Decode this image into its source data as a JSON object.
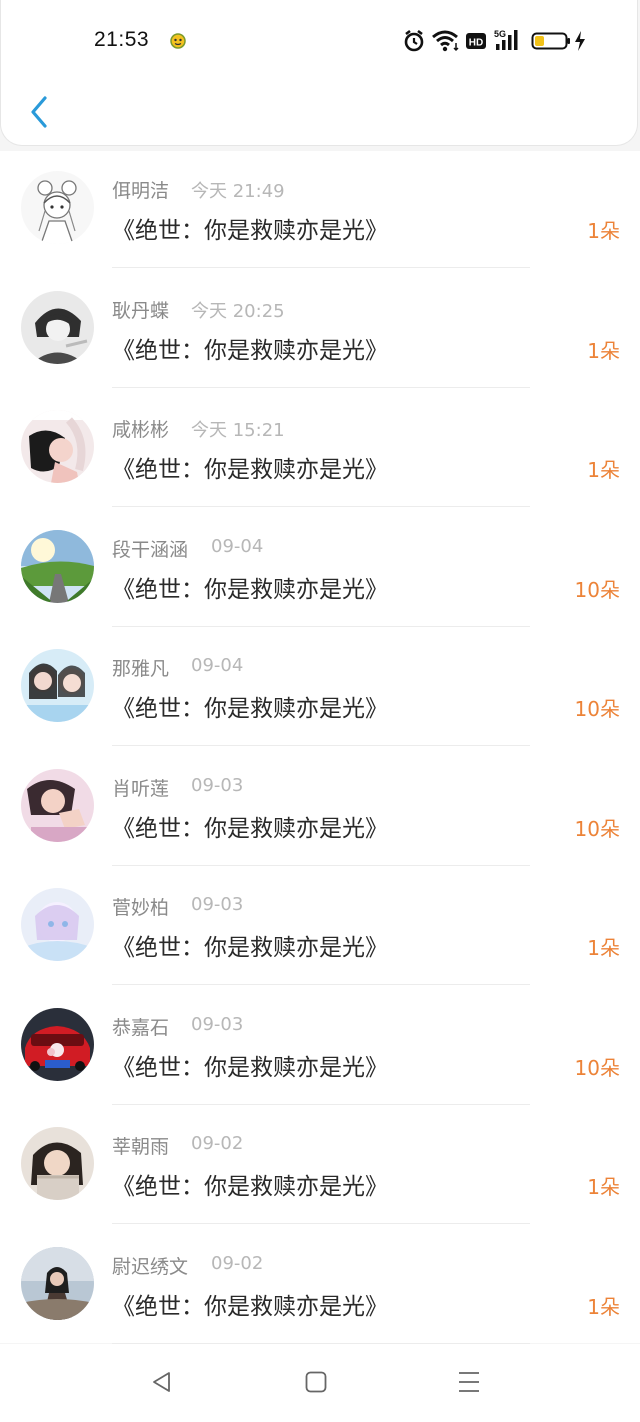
{
  "status_bar": {
    "time": "21:53",
    "icons": [
      "notification-icon",
      "alarm-icon",
      "wifi-icon",
      "hd-icon",
      "signal-5g-icon",
      "battery-icon",
      "charging-icon"
    ],
    "hd_label": "HD",
    "network_label": "5G"
  },
  "header": {
    "back_icon": "chevron-left-icon"
  },
  "colors": {
    "accent_blue": "#2a9ad9",
    "count_orange": "#ec8338"
  },
  "items": [
    {
      "name": "佴明洁",
      "time": "今天 21:49",
      "title": "《绝世：你是救赎亦是光》",
      "count": "1朵"
    },
    {
      "name": "耿丹蝶",
      "time": "今天 20:25",
      "title": "《绝世：你是救赎亦是光》",
      "count": "1朵"
    },
    {
      "name": "咸彬彬",
      "time": "今天 15:21",
      "title": "《绝世：你是救赎亦是光》",
      "count": "1朵"
    },
    {
      "name": "段干涵涵",
      "time": "09-04",
      "title": "《绝世：你是救赎亦是光》",
      "count": "10朵"
    },
    {
      "name": "那雅凡",
      "time": "09-04",
      "title": "《绝世：你是救赎亦是光》",
      "count": "10朵"
    },
    {
      "name": "肖听莲",
      "time": "09-03",
      "title": "《绝世：你是救赎亦是光》",
      "count": "10朵"
    },
    {
      "name": "菅妙柏",
      "time": "09-03",
      "title": "《绝世：你是救赎亦是光》",
      "count": "1朵"
    },
    {
      "name": "恭嘉石",
      "time": "09-03",
      "title": "《绝世：你是救赎亦是光》",
      "count": "10朵"
    },
    {
      "name": "莘朝雨",
      "time": "09-02",
      "title": "《绝世：你是救赎亦是光》",
      "count": "1朵"
    },
    {
      "name": "尉迟绣文",
      "time": "09-02",
      "title": "《绝世：你是救赎亦是光》",
      "count": "1朵"
    }
  ],
  "nav_bar": {
    "buttons": [
      "back-triangle-icon",
      "home-square-icon",
      "menu-lines-icon"
    ]
  }
}
